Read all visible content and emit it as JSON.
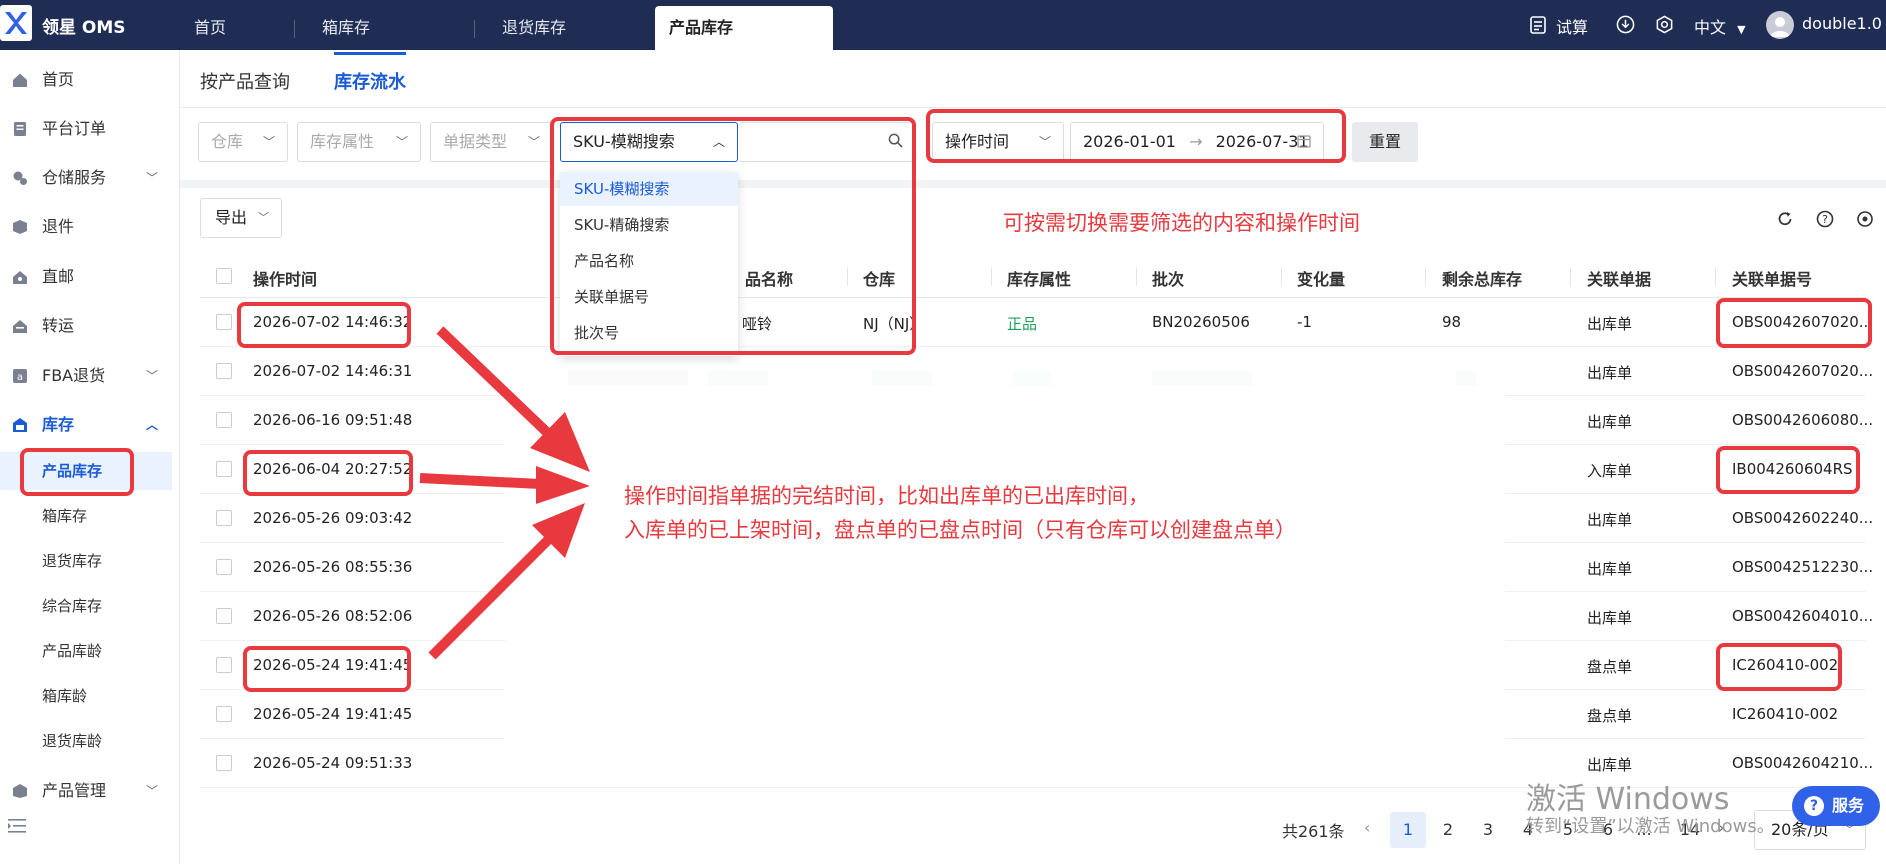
{
  "topbar": {
    "brand": "领星 OMS",
    "tabs": [
      {
        "label": "首页"
      },
      {
        "label": "箱库存"
      },
      {
        "label": "退货库存"
      },
      {
        "label": "产品库存",
        "active": true
      }
    ],
    "calc_label": "试算",
    "lang_label": "中文",
    "username": "double1.0"
  },
  "sidebar": {
    "items": [
      {
        "label": "首页",
        "icon": "home-icon"
      },
      {
        "label": "平台订单",
        "icon": "order-icon"
      },
      {
        "label": "仓储服务",
        "icon": "warehouse-service-icon",
        "expandable": true
      },
      {
        "label": "退件",
        "icon": "return-icon"
      },
      {
        "label": "直邮",
        "icon": "direct-mail-icon"
      },
      {
        "label": "转运",
        "icon": "transfer-icon"
      },
      {
        "label": "FBA退货",
        "icon": "fba-icon",
        "expandable": true
      },
      {
        "label": "库存",
        "icon": "inventory-icon",
        "expanded": true
      },
      {
        "label": "产品管理",
        "icon": "product-icon",
        "expandable": true
      }
    ],
    "inventory_children": [
      {
        "label": "产品库存",
        "active": true
      },
      {
        "label": "箱库存"
      },
      {
        "label": "退货库存"
      },
      {
        "label": "综合库存"
      },
      {
        "label": "产品库龄"
      },
      {
        "label": "箱库龄"
      },
      {
        "label": "退货库龄"
      }
    ]
  },
  "subtabs": [
    {
      "label": "按产品查询"
    },
    {
      "label": "库存流水",
      "active": true
    }
  ],
  "filters": {
    "warehouse_placeholder": "仓库",
    "stock_attr_placeholder": "库存属性",
    "doc_type_placeholder": "单据类型",
    "search_type_value": "SKU-模糊搜索",
    "time_type_value": "操作时间",
    "date_start": "2026-01-01",
    "date_end": "2026-07-31",
    "reset_label": "重置"
  },
  "search_type_options": [
    "SKU-模糊搜索",
    "SKU-精确搜索",
    "产品名称",
    "关联单据号",
    "批次号"
  ],
  "toolbar": {
    "export_label": "导出"
  },
  "table": {
    "columns": [
      "操作时间",
      "品名称",
      "仓库",
      "库存属性",
      "批次",
      "变化量",
      "剩余总库存",
      "关联单据",
      "关联单据号"
    ],
    "rows": [
      {
        "time": "2026-07-02 14:46:32",
        "name": "哑铃",
        "warehouse": "NJ（NJ）",
        "attr": "正品",
        "batch": "BN20260506",
        "change": "-1",
        "remaining": "98",
        "doc": "出库单",
        "doc_no": "OBS0042607020..."
      },
      {
        "time": "2026-07-02 14:46:31",
        "name": "",
        "warehouse": "",
        "attr": "",
        "batch": "",
        "change": "",
        "remaining": "",
        "doc": "出库单",
        "doc_no": "OBS0042607020..."
      },
      {
        "time": "2026-06-16 09:51:48",
        "name": "",
        "warehouse": "",
        "attr": "",
        "batch": "",
        "change": "",
        "remaining": "",
        "doc": "出库单",
        "doc_no": "OBS0042606080..."
      },
      {
        "time": "2026-06-04 20:27:52",
        "name": "",
        "warehouse": "",
        "attr": "",
        "batch": "",
        "change": "",
        "remaining": "",
        "doc": "入库单",
        "doc_no": "IB004260604RS"
      },
      {
        "time": "2026-05-26 09:03:42",
        "name": "",
        "warehouse": "",
        "attr": "",
        "batch": "",
        "change": "",
        "remaining": "",
        "doc": "出库单",
        "doc_no": "OBS0042602240..."
      },
      {
        "time": "2026-05-26 08:55:36",
        "name": "",
        "warehouse": "",
        "attr": "",
        "batch": "",
        "change": "",
        "remaining": "",
        "doc": "出库单",
        "doc_no": "OBS0042512230..."
      },
      {
        "time": "2026-05-26 08:52:06",
        "name": "",
        "warehouse": "",
        "attr": "",
        "batch": "",
        "change": "",
        "remaining": "",
        "doc": "出库单",
        "doc_no": "OBS0042604010..."
      },
      {
        "time": "2026-05-24 19:41:45",
        "name": "",
        "warehouse": "",
        "attr": "",
        "batch": "",
        "change": "",
        "remaining": "",
        "doc": "盘点单",
        "doc_no": "IC260410-002"
      },
      {
        "time": "2026-05-24 19:41:45",
        "name": "",
        "warehouse": "",
        "attr": "",
        "batch": "",
        "change": "",
        "remaining": "",
        "doc": "盘点单",
        "doc_no": "IC260410-002"
      },
      {
        "time": "2026-05-24 09:51:33",
        "name": "",
        "warehouse": "",
        "attr": "",
        "batch": "",
        "change": "",
        "remaining": "",
        "doc": "出库单",
        "doc_no": "OBS0042604210..."
      }
    ]
  },
  "annotations": {
    "top_note": "可按需切换需要筛选的内容和操作时间",
    "mid_note_line1": "操作时间指单据的完结时间，比如出库单的已出库时间，",
    "mid_note_line2": "入库单的已上架时间，盘点单的已盘点时间（只有仓库可以创建盘点单）"
  },
  "pagination": {
    "total": "共261条",
    "pages": [
      "1",
      "2",
      "3",
      "4",
      "5",
      "6",
      "14"
    ],
    "current": "1",
    "ellipsis": "...",
    "page_size": "20条/页"
  },
  "windows_watermark": {
    "line1": "激活 Windows",
    "line2": "转到“设置”以激活 Windows。"
  },
  "service_button": {
    "label": "服务"
  },
  "colors": {
    "topbar": "#1f2d55",
    "accent": "#1a5bd6",
    "annotation": "#e8393f",
    "positive": "#1aa35b"
  }
}
